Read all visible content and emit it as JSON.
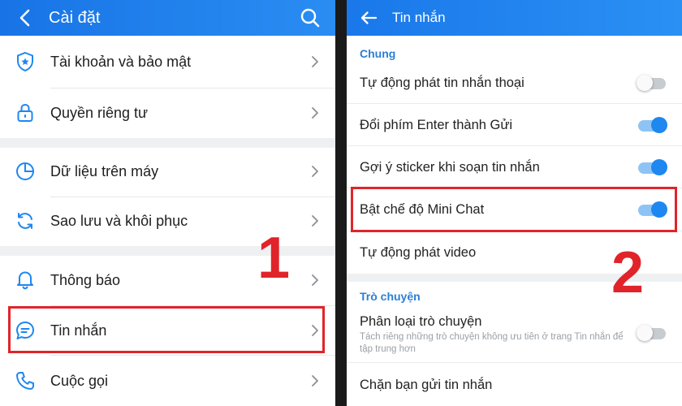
{
  "colors": {
    "accent": "#1e87f0",
    "highlight": "#e0242a",
    "header": "#1874e6"
  },
  "left": {
    "header": {
      "title": "Cài đặt",
      "back_icon": "chevron-left-icon",
      "search_icon": "search-icon"
    },
    "items": [
      {
        "label": "Tài khoản và bảo mật",
        "icon": "shield-icon"
      },
      {
        "label": "Quyền riêng tư",
        "icon": "lock-icon"
      },
      {
        "label": "Dữ liệu trên máy",
        "icon": "pie-chart-icon"
      },
      {
        "label": "Sao lưu và khôi phục",
        "icon": "sync-icon"
      },
      {
        "label": "Thông báo",
        "icon": "bell-icon"
      },
      {
        "label": "Tin nhắn",
        "icon": "chat-icon",
        "highlighted": true
      },
      {
        "label": "Cuộc gọi",
        "icon": "phone-icon"
      }
    ],
    "step_number": "1"
  },
  "right": {
    "header": {
      "title": "Tin nhắn",
      "back_icon": "arrow-left-icon"
    },
    "sections": [
      {
        "title": "Chung",
        "settings": [
          {
            "label": "Tự động phát tin nhắn thoại",
            "toggle": false
          },
          {
            "label": "Đổi phím Enter thành Gửi",
            "toggle": true
          },
          {
            "label": "Gợi ý sticker khi soạn tin nhắn",
            "toggle": true
          },
          {
            "label": "Bật chế độ Mini Chat",
            "toggle": true,
            "highlighted": true
          },
          {
            "label": "Tự động phát video"
          }
        ]
      },
      {
        "title": "Trò chuyện",
        "settings": [
          {
            "label": "Phân loại trò chuyện",
            "description": "Tách riêng những trò chuyện không ưu tiên ở trang Tin nhắn để tập trung hơn",
            "toggle": false
          },
          {
            "label": "Chặn bạn gửi tin nhắn"
          }
        ]
      }
    ],
    "step_number": "2"
  }
}
